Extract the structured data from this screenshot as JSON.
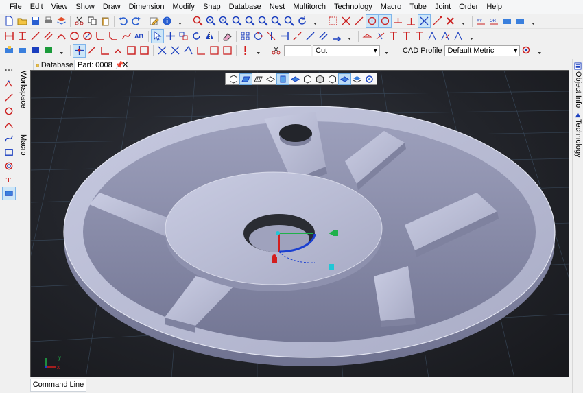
{
  "menu": [
    "File",
    "Edit",
    "View",
    "Show",
    "Draw",
    "Dimension",
    "Modify",
    "Snap",
    "Database",
    "Nest",
    "Multitorch",
    "Technology",
    "Macro",
    "Tube",
    "Joint",
    "Order",
    "Help"
  ],
  "toolbar3": {
    "cut_value": "Cut",
    "cad_profile_label": "CAD Profile",
    "cad_profile_value": "Default Metric"
  },
  "tabs": {
    "database": "Database",
    "part": "Part: 0008"
  },
  "left_panels": {
    "workspace": "Workspace",
    "macro": "Macro"
  },
  "right_panels": {
    "object_info": "Object Info",
    "technology": "Technology"
  },
  "command_line": "Command Line",
  "axis_labels": {
    "x": "x",
    "y": "y"
  },
  "colors": {
    "viewport_bg": "#1f2126",
    "part_top": "#bcbfd6",
    "part_side": "#8c8fab",
    "grid": "#3a4a5c",
    "accent_blue": "#1a3fd1",
    "gizmo_green": "#1fb14a",
    "gizmo_red": "#d31e1e",
    "gizmo_cyan": "#20c7d6"
  }
}
